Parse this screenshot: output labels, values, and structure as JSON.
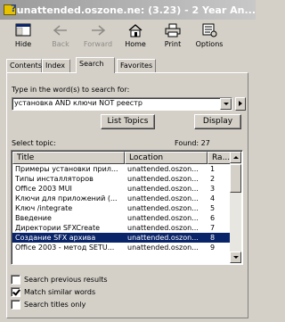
{
  "window": {
    "title": "unattended.oszone.ne: (3.23) - 2 Year An..."
  },
  "toolbar": {
    "buttons": [
      {
        "label": "Hide",
        "icon": "hide-icon",
        "enabled": true
      },
      {
        "label": "Back",
        "icon": "back-arrow-icon",
        "enabled": false
      },
      {
        "label": "Forward",
        "icon": "forward-arrow-icon",
        "enabled": false
      },
      {
        "label": "Home",
        "icon": "home-icon",
        "enabled": true
      },
      {
        "label": "Print",
        "icon": "printer-icon",
        "enabled": true
      },
      {
        "label": "Options",
        "icon": "options-icon",
        "enabled": true
      }
    ]
  },
  "tabs": [
    {
      "label": "Contents",
      "active": false
    },
    {
      "label": "Index",
      "active": false
    },
    {
      "label": "Search",
      "active": true
    },
    {
      "label": "Favorites",
      "active": false
    }
  ],
  "search": {
    "prompt": "Type in the word(s) to search for:",
    "query": "установка AND ключи NOT реестр",
    "list_topics_label": "List Topics",
    "display_label": "Display"
  },
  "results": {
    "select_label": "Select topic:",
    "found_label": "Found: 27",
    "columns": [
      "Title",
      "Location",
      "Ra..."
    ],
    "rows": [
      {
        "title": "Примеры установки прил...",
        "location": "unattended.oszon...",
        "rank": "1",
        "selected": false
      },
      {
        "title": "Типы инсталляторов",
        "location": "unattended.oszon...",
        "rank": "2",
        "selected": false
      },
      {
        "title": "Office 2003 MUI",
        "location": "unattended.oszon...",
        "rank": "3",
        "selected": false
      },
      {
        "title": "Ключи для приложений (...",
        "location": "unattended.oszon...",
        "rank": "4",
        "selected": false
      },
      {
        "title": "Ключ /integrate",
        "location": "unattended.oszon...",
        "rank": "5",
        "selected": false
      },
      {
        "title": "Введение",
        "location": "unattended.oszon...",
        "rank": "6",
        "selected": false
      },
      {
        "title": "Директории SFXCreate",
        "location": "unattended.oszon...",
        "rank": "7",
        "selected": false
      },
      {
        "title": "Создание SFX архива",
        "location": "unattended.oszon...",
        "rank": "8",
        "selected": true
      },
      {
        "title": "Office 2003 - метод SETU...",
        "location": "unattended.oszon...",
        "rank": "9",
        "selected": false
      }
    ]
  },
  "options": [
    {
      "label": "Search previous results",
      "checked": false
    },
    {
      "label": "Match similar words",
      "checked": true
    },
    {
      "label": "Search titles only",
      "checked": false
    }
  ],
  "colors": {
    "selection": "#0a246a",
    "face": "#d4d0c8"
  }
}
